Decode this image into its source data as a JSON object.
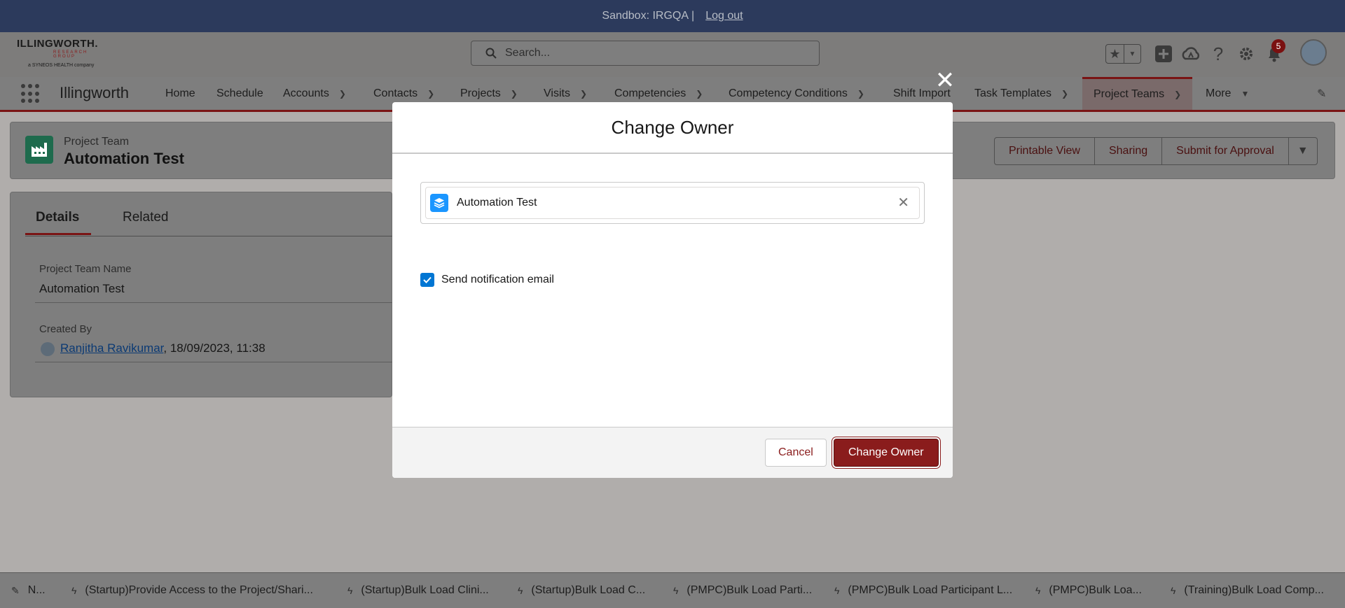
{
  "sandbox": {
    "text": "Sandbox: IRGQA",
    "separator": "|",
    "logout": "Log out"
  },
  "logo": {
    "line1": "ILLINGWORTH.",
    "line2": "RESEARCH GROUP",
    "line3": "a SYNEOS HEALTH company"
  },
  "search": {
    "placeholder": "Search..."
  },
  "header": {
    "notification_count": "5"
  },
  "nav": {
    "app_name": "Illingworth",
    "items": [
      {
        "label": "Home",
        "has_menu": false
      },
      {
        "label": "Schedule",
        "has_menu": false
      },
      {
        "label": "Accounts",
        "has_menu": true
      },
      {
        "label": "Contacts",
        "has_menu": true
      },
      {
        "label": "Projects",
        "has_menu": true
      },
      {
        "label": "Visits",
        "has_menu": true
      },
      {
        "label": "Competencies",
        "has_menu": true
      },
      {
        "label": "Competency Conditions",
        "has_menu": true
      },
      {
        "label": "Shift Import",
        "has_menu": false
      },
      {
        "label": "Task Templates",
        "has_menu": true
      },
      {
        "label": "Project Teams",
        "has_menu": true,
        "active": true
      },
      {
        "label": "More",
        "has_menu": true
      }
    ]
  },
  "record": {
    "type": "Project Team",
    "title": "Automation Test",
    "actions": [
      "Printable View",
      "Sharing",
      "Submit for Approval"
    ]
  },
  "details": {
    "tabs": [
      "Details",
      "Related"
    ],
    "active_tab": "Details",
    "fields": [
      {
        "label": "Project Team Name",
        "value": "Automation Test"
      },
      {
        "label": "Created By",
        "owner": "Ranjitha Ravikumar",
        "value": ", 18/09/2023, 11:38"
      }
    ]
  },
  "modal": {
    "title": "Change Owner",
    "selected_record": "Automation Test",
    "checkbox_label": "Send notification email",
    "checkbox_checked": true,
    "cancel": "Cancel",
    "confirm": "Change Owner"
  },
  "utility_bar": {
    "items": [
      {
        "label": "N...",
        "icon": "note-icon"
      },
      {
        "label": "(Startup)Provide Access to the Project/Shari...",
        "icon": "bolt-icon"
      },
      {
        "label": "(Startup)Bulk Load Clini...",
        "icon": "bolt-icon"
      },
      {
        "label": "(Startup)Bulk Load C...",
        "icon": "bolt-icon"
      },
      {
        "label": "(PMPC)Bulk Load Parti...",
        "icon": "bolt-icon"
      },
      {
        "label": "(PMPC)Bulk Load Participant L...",
        "icon": "bolt-icon"
      },
      {
        "label": "(PMPC)Bulk Loa...",
        "icon": "bolt-icon"
      },
      {
        "label": "(Training)Bulk Load Comp...",
        "icon": "bolt-icon"
      }
    ]
  },
  "colors": {
    "brand": "#8a1c1c",
    "checkbox": "#0176d3",
    "lookup_icon": "#1b96ff",
    "record_icon": "#1e6b4d"
  }
}
